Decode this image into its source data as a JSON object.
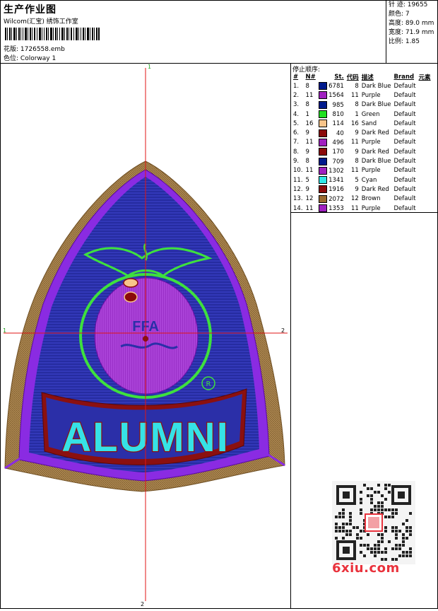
{
  "header": {
    "title": "生产作业图",
    "brand_line": "Wilcom(汇宝) 绣饰工作室",
    "file_label": "花版:",
    "file_value": "1726558.emb",
    "colorway_label": "色位:",
    "colorway_value": "Colorway 1"
  },
  "specs": [
    {
      "label": "针 迹:",
      "value": "19655"
    },
    {
      "label": "颜色:",
      "value": "7"
    },
    {
      "label": "高度:",
      "value": "89.0 mm"
    },
    {
      "label": "宽度:",
      "value": "71.9 mm"
    },
    {
      "label": "比例:",
      "value": "1.85"
    }
  ],
  "design": {
    "marker_top": "1",
    "marker_bottom": "2",
    "marker_left": "1",
    "marker_right": "2",
    "text": "ALUMNI",
    "emblem_text": "FFA",
    "reg_mark": "R",
    "colors": {
      "brown": "#a57f4a",
      "purple": "#8a2be2",
      "blue": "#2b2fa8",
      "green": "#3ee03e",
      "cyan": "#36e2e6",
      "darkred": "#8b1010",
      "globe": "#9b28c8",
      "crosshair": "#e01515"
    }
  },
  "stop_sequence": {
    "title": "停止顺序:",
    "columns": [
      "#",
      "N#",
      "St.",
      "代码",
      "描述",
      "Brand",
      "元素"
    ],
    "rows": [
      {
        "idx": "1.",
        "n": "8",
        "color": "#001a8c",
        "st": "6781",
        "code": "8",
        "desc": "Dark Blue",
        "brand": "Default"
      },
      {
        "idx": "2.",
        "n": "11",
        "color": "#a020c0",
        "st": "1564",
        "code": "11",
        "desc": "Purple",
        "brand": "Default"
      },
      {
        "idx": "3.",
        "n": "8",
        "color": "#001a8c",
        "st": "985",
        "code": "8",
        "desc": "Dark Blue",
        "brand": "Default"
      },
      {
        "idx": "4.",
        "n": "1",
        "color": "#20e020",
        "st": "810",
        "code": "1",
        "desc": "Green",
        "brand": "Default"
      },
      {
        "idx": "5.",
        "n": "16",
        "color": "#f7c48a",
        "st": "114",
        "code": "16",
        "desc": "Sand",
        "brand": "Default"
      },
      {
        "idx": "6.",
        "n": "9",
        "color": "#8a0a0a",
        "st": "40",
        "code": "9",
        "desc": "Dark Red",
        "brand": "Default"
      },
      {
        "idx": "7.",
        "n": "11",
        "color": "#a020c0",
        "st": "496",
        "code": "11",
        "desc": "Purple",
        "brand": "Default"
      },
      {
        "idx": "8.",
        "n": "9",
        "color": "#8a0a0a",
        "st": "170",
        "code": "9",
        "desc": "Dark Red",
        "brand": "Default"
      },
      {
        "idx": "9.",
        "n": "8",
        "color": "#001a8c",
        "st": "709",
        "code": "8",
        "desc": "Dark Blue",
        "brand": "Default"
      },
      {
        "idx": "10.",
        "n": "11",
        "color": "#a020c0",
        "st": "1302",
        "code": "11",
        "desc": "Purple",
        "brand": "Default"
      },
      {
        "idx": "11.",
        "n": "5",
        "color": "#30e8e8",
        "st": "1341",
        "code": "5",
        "desc": "Cyan",
        "brand": "Default"
      },
      {
        "idx": "12.",
        "n": "9",
        "color": "#8a0a0a",
        "st": "1916",
        "code": "9",
        "desc": "Dark Red",
        "brand": "Default"
      },
      {
        "idx": "13.",
        "n": "12",
        "color": "#9a6a30",
        "st": "2072",
        "code": "12",
        "desc": "Brown",
        "brand": "Default"
      },
      {
        "idx": "14.",
        "n": "11",
        "color": "#a020c0",
        "st": "1353",
        "code": "11",
        "desc": "Purple",
        "brand": "Default"
      }
    ]
  },
  "watermark": "6xiu.com"
}
